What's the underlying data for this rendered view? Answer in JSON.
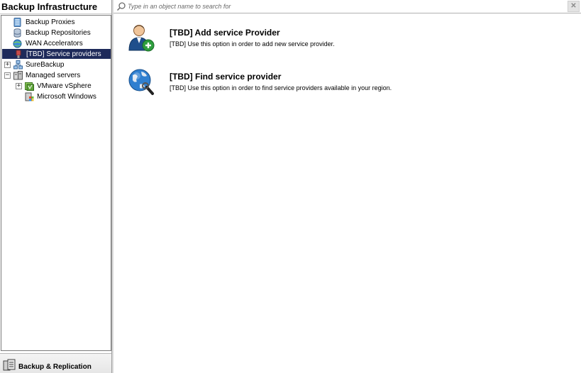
{
  "left_panel": {
    "title": "Backup Infrastructure",
    "tree": [
      {
        "label": "Backup Proxies",
        "icon": "proxy-server-icon"
      },
      {
        "label": "Backup Repositories",
        "icon": "repository-icon"
      },
      {
        "label": "WAN Accelerators",
        "icon": "wan-accelerator-icon"
      },
      {
        "label": "[TBD] Service providers",
        "icon": "service-provider-icon",
        "selected": true
      },
      {
        "label": "SureBackup",
        "icon": "surebackup-icon",
        "expander": "+"
      },
      {
        "label": "Managed servers",
        "icon": "managed-servers-icon",
        "expander": "−"
      },
      {
        "label": "VMware vSphere",
        "icon": "vmware-vsphere-icon",
        "expander": "+"
      },
      {
        "label": "Microsoft Windows",
        "icon": "windows-server-icon"
      }
    ],
    "bottom_nav": {
      "label": "Backup & Replication",
      "icon": "backup-replication-icon"
    }
  },
  "search": {
    "placeholder": "Type in an object name to search for",
    "clear_label": "✕"
  },
  "actions": [
    {
      "title": "[TBD] Add service Provider",
      "description": "[TBD] Use this option in order to add new service provider.",
      "icon": "add-user-icon"
    },
    {
      "title": "[TBD] Find service provider",
      "description": "[TBD] Use this option in order to find service providers available in your region.",
      "icon": "globe-search-icon"
    }
  ],
  "colors": {
    "selection": "#1e2a5a",
    "accent_green": "#2e9e3e"
  }
}
